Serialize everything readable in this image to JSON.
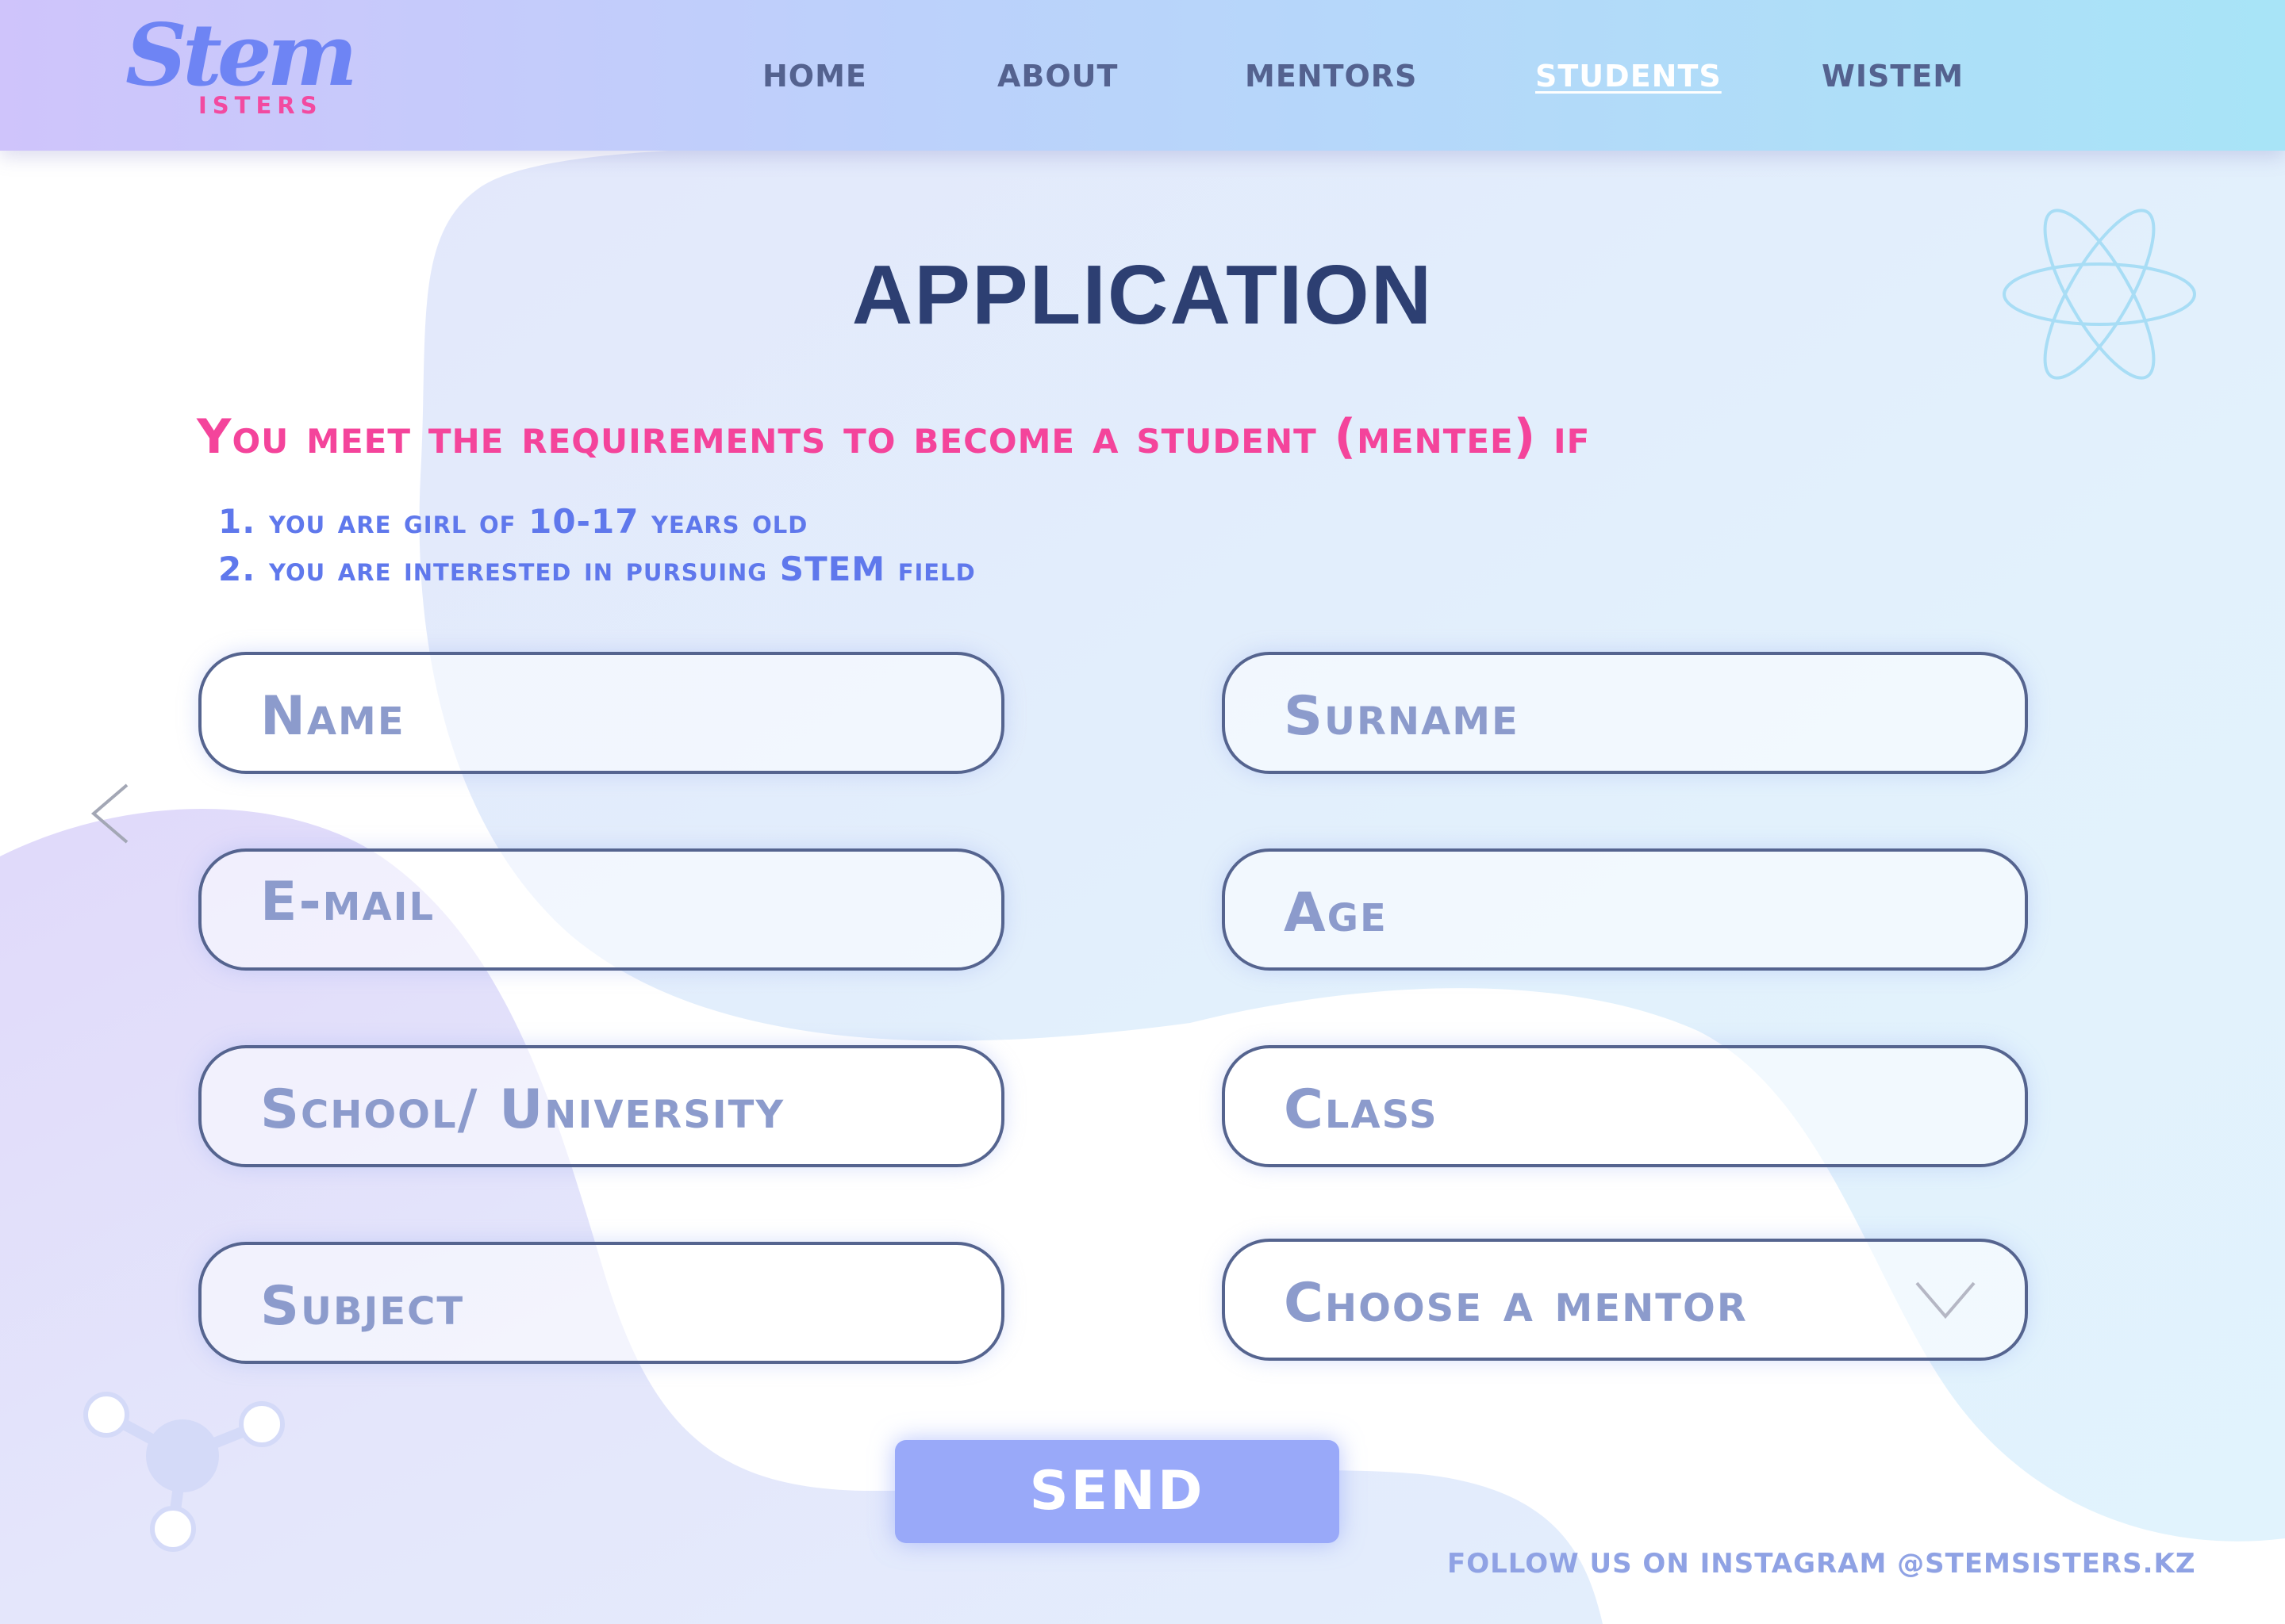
{
  "logo": {
    "main": "Stem",
    "sub": "ISTERS"
  },
  "nav": {
    "items": [
      {
        "label": "HOME",
        "active": false
      },
      {
        "label": "ABOUT",
        "active": false
      },
      {
        "label": "MENTORS",
        "active": false
      },
      {
        "label": "STUDENTS",
        "active": true
      },
      {
        "label": "WISTEM",
        "active": false
      }
    ]
  },
  "page": {
    "title": "APPLICATION"
  },
  "requirements": {
    "heading": "You meet the requirements to become a student (mentee) if",
    "items": [
      {
        "num": "1.",
        "text": "you are girl of 10-17 years old"
      },
      {
        "num": "2.",
        "text": "you are interested in pursuing STEM field"
      }
    ]
  },
  "form": {
    "name": "Name",
    "surname": "Surname",
    "email": "E-mail",
    "age": "Age",
    "school": "School/ University",
    "class": "Class",
    "subject": "Subject",
    "mentor": "Choose a mentor",
    "send": "SEND"
  },
  "footer": {
    "instagram": "FOLLOW US ON INSTAGRAM @STEMSISTERS.KZ"
  },
  "colors": {
    "accent_pink": "#f4449b",
    "accent_blue": "#5f78ec",
    "title": "#2d3f72",
    "field_border": "#55648f",
    "button": "#99a9f9"
  },
  "icons": {
    "back": "chevron-left-icon",
    "dropdown": "chevron-down-icon",
    "decor_1": "atom-icon",
    "decor_2": "molecule-icon"
  }
}
